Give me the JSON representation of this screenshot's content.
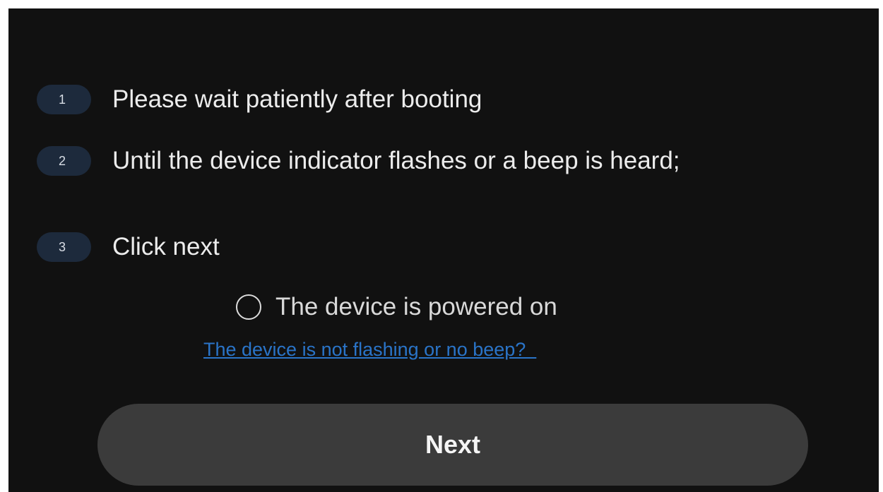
{
  "steps": [
    {
      "number": "1",
      "text": "Please wait patiently after booting"
    },
    {
      "number": "2",
      "text": "Until the device indicator flashes or a beep is heard;"
    },
    {
      "number": "3",
      "text": "Click next"
    }
  ],
  "power_check": {
    "label": "The device is powered on",
    "checked": false
  },
  "help_link": {
    "text": "The device is not flashing or no beep?  "
  },
  "next_button": {
    "label": "Next"
  },
  "colors": {
    "background": "#111111",
    "badge": "#1d2a3c",
    "link": "#2a74c8",
    "button": "#3b3b3b"
  }
}
